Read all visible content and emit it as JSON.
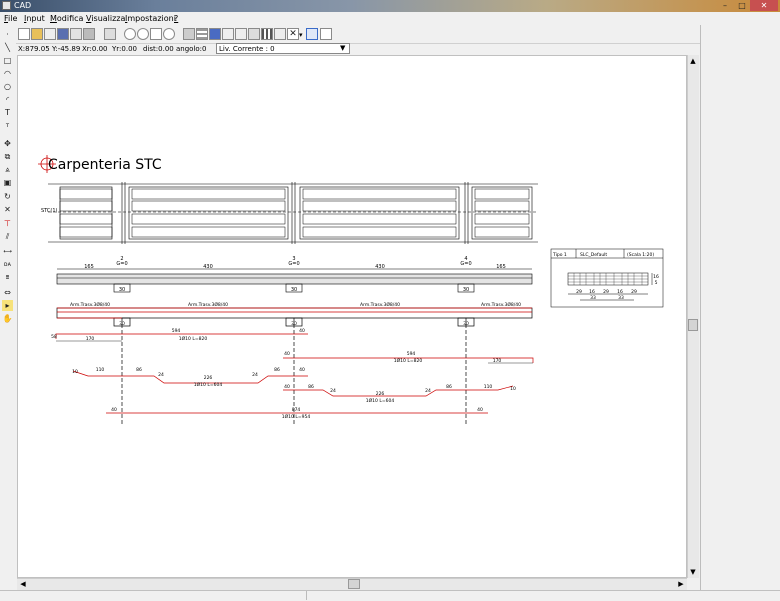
{
  "window": {
    "title": "CAD",
    "minimize": "–",
    "maximize": "□",
    "close": "✕"
  },
  "menu": [
    {
      "label": "File",
      "ul": "F",
      "rest": "ile"
    },
    {
      "label": "Input",
      "ul": "I",
      "rest": "nput"
    },
    {
      "label": "Modifica",
      "ul": "M",
      "rest": "odifica"
    },
    {
      "label": "Visualizza",
      "ul": "V",
      "rest": "isualizza"
    },
    {
      "label": "Impostazioni",
      "ul": "I",
      "rest": "mpostazioni"
    },
    {
      "label": "?",
      "ul": "?",
      "rest": ""
    }
  ],
  "status": {
    "x": "X:879.05",
    "y": "Y:-45.89",
    "xr": "Xr:0.00",
    "yr": "Yr:0.00",
    "dist": "dist:0.00",
    "angolo": "angolo:0",
    "livello": "Liv. Corrente : 0"
  },
  "drawing": {
    "title": "Carpenteria STC",
    "section_label": "STC(1)",
    "supports": [
      {
        "id": "2",
        "g": "G=0"
      },
      {
        "id": "3",
        "g": "G=0"
      },
      {
        "id": "4",
        "g": "G=0"
      }
    ],
    "span_dims": [
      "165",
      "430",
      "430",
      "165"
    ],
    "support_width": "30",
    "arm_labels": [
      "Arm.Trasv.3Ø8/40",
      "Arm.Trasv.3Ø8/40",
      "Arm.Trasv.3Ø8/40",
      "Arm.Trasv.3Ø8/40"
    ],
    "bars": {
      "b1_top": "594",
      "b1_left": "170",
      "b1_right": "40",
      "b1_spec": "1Ø10 L=820",
      "b1_hook": "58",
      "b2_left": "40",
      "b2_top": "594",
      "b2_right": "170",
      "b2_spec": "1Ø10 L=820",
      "b3_a": "10",
      "b3_b": "110",
      "b3_c": "86",
      "b3_d": "24",
      "b3_e": "226",
      "b3_f": "24",
      "b3_g": "86",
      "b3_h": "40",
      "b3_spec": "1Ø10 L=604",
      "b4_a": "40",
      "b4_b": "86",
      "b4_c": "24",
      "b4_d": "226",
      "b4_e": "24",
      "b4_f": "86",
      "b4_g": "110",
      "b4_h": "10",
      "b4_spec": "1Ø10 L=604",
      "b5_left": "40",
      "b5_top": "874",
      "b5_right": "40",
      "b5_spec": "1Ø10 L=954"
    },
    "section_box": {
      "tipo": "Tipo 1",
      "slc": "SLC_Default",
      "scala": "(Scala 1:20)",
      "dims": [
        "29",
        "16",
        "29",
        "16",
        "29"
      ],
      "totals": [
        "33",
        "33"
      ],
      "side_a": "16",
      "side_b": "5"
    }
  }
}
